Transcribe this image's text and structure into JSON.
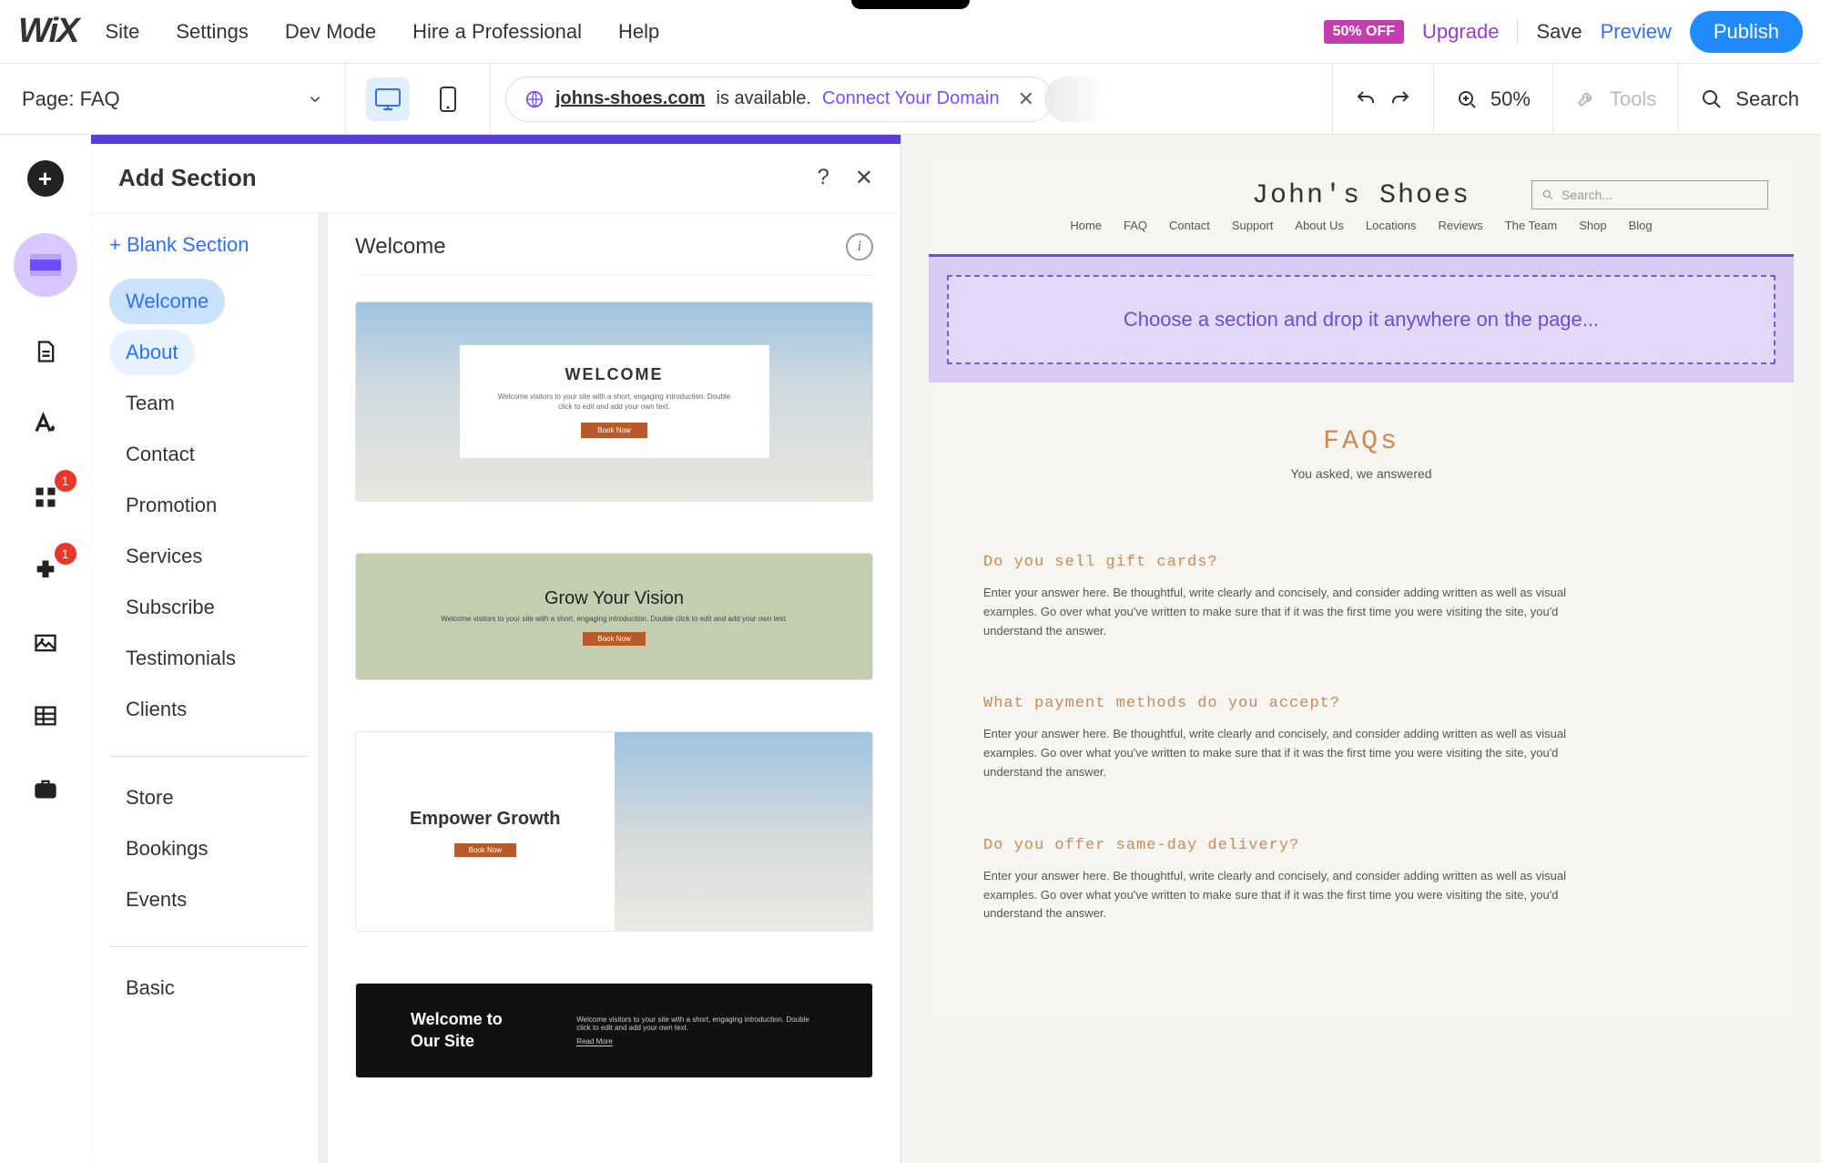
{
  "topbar": {
    "logo": "WiX",
    "menu": [
      "Site",
      "Settings",
      "Dev Mode",
      "Hire a Professional",
      "Help"
    ],
    "promo_badge": "50% OFF",
    "upgrade": "Upgrade",
    "save": "Save",
    "preview": "Preview",
    "publish": "Publish"
  },
  "subbar": {
    "page_label": "Page: FAQ",
    "domain": "johns-shoes.com",
    "domain_suffix": "is available.",
    "connect": "Connect Your Domain",
    "zoom": "50%",
    "tools": "Tools",
    "search": "Search"
  },
  "iconrail": {
    "badges": {
      "apps": "1",
      "addons": "1"
    }
  },
  "panel": {
    "title": "Add Section",
    "blank": "+  Blank Section",
    "categories_a": [
      "Welcome",
      "About",
      "Team",
      "Contact",
      "Promotion",
      "Services",
      "Subscribe",
      "Testimonials",
      "Clients"
    ],
    "categories_b": [
      "Store",
      "Bookings",
      "Events"
    ],
    "categories_c": [
      "Basic"
    ],
    "section_heading": "Welcome",
    "templates": [
      {
        "title": "WELCOME",
        "sub": "Welcome visitors to your site with a short, engaging introduction. Double click to edit and add your own text.",
        "btn": "Book Now"
      },
      {
        "title": "Grow Your Vision",
        "sub": "Welcome visitors to your site with a short, engaging introduction. Double click to edit and add your own text.",
        "btn": "Book Now"
      },
      {
        "title": "Empower Growth",
        "btn": "Book Now"
      },
      {
        "title": "Welcome to Our Site",
        "sub": "Welcome visitors to your site with a short, engaging introduction. Double click to edit and add your own text.",
        "btn": "Read More"
      }
    ]
  },
  "preview": {
    "site_title": "John's Shoes",
    "search_placeholder": "Search...",
    "nav": [
      "Home",
      "FAQ",
      "Contact",
      "Support",
      "About Us",
      "Locations",
      "Reviews",
      "The Team",
      "Shop",
      "Blog"
    ],
    "dropzone": "Choose a section and drop it anywhere on the page...",
    "faq_title": "FAQs",
    "faq_sub": "You asked, we answered",
    "faqs": [
      {
        "q": "Do you sell gift cards?",
        "a": "Enter your answer here. Be thoughtful, write clearly and concisely, and consider adding written as well as visual examples. Go over what you've written to make sure that if it was the first time you were visiting the site, you'd understand the answer."
      },
      {
        "q": "What payment methods do you accept?",
        "a": "Enter your answer here. Be thoughtful, write clearly and concisely, and consider adding written as well as visual examples. Go over what you've written to make sure that if it was the first time you were visiting the site, you'd understand the answer."
      },
      {
        "q": "Do you offer same-day delivery?",
        "a": "Enter your answer here. Be thoughtful, write clearly and concisely, and consider adding written as well as visual examples. Go over what you've written to make sure that if it was the first time you were visiting the site, you'd understand the answer."
      }
    ]
  }
}
